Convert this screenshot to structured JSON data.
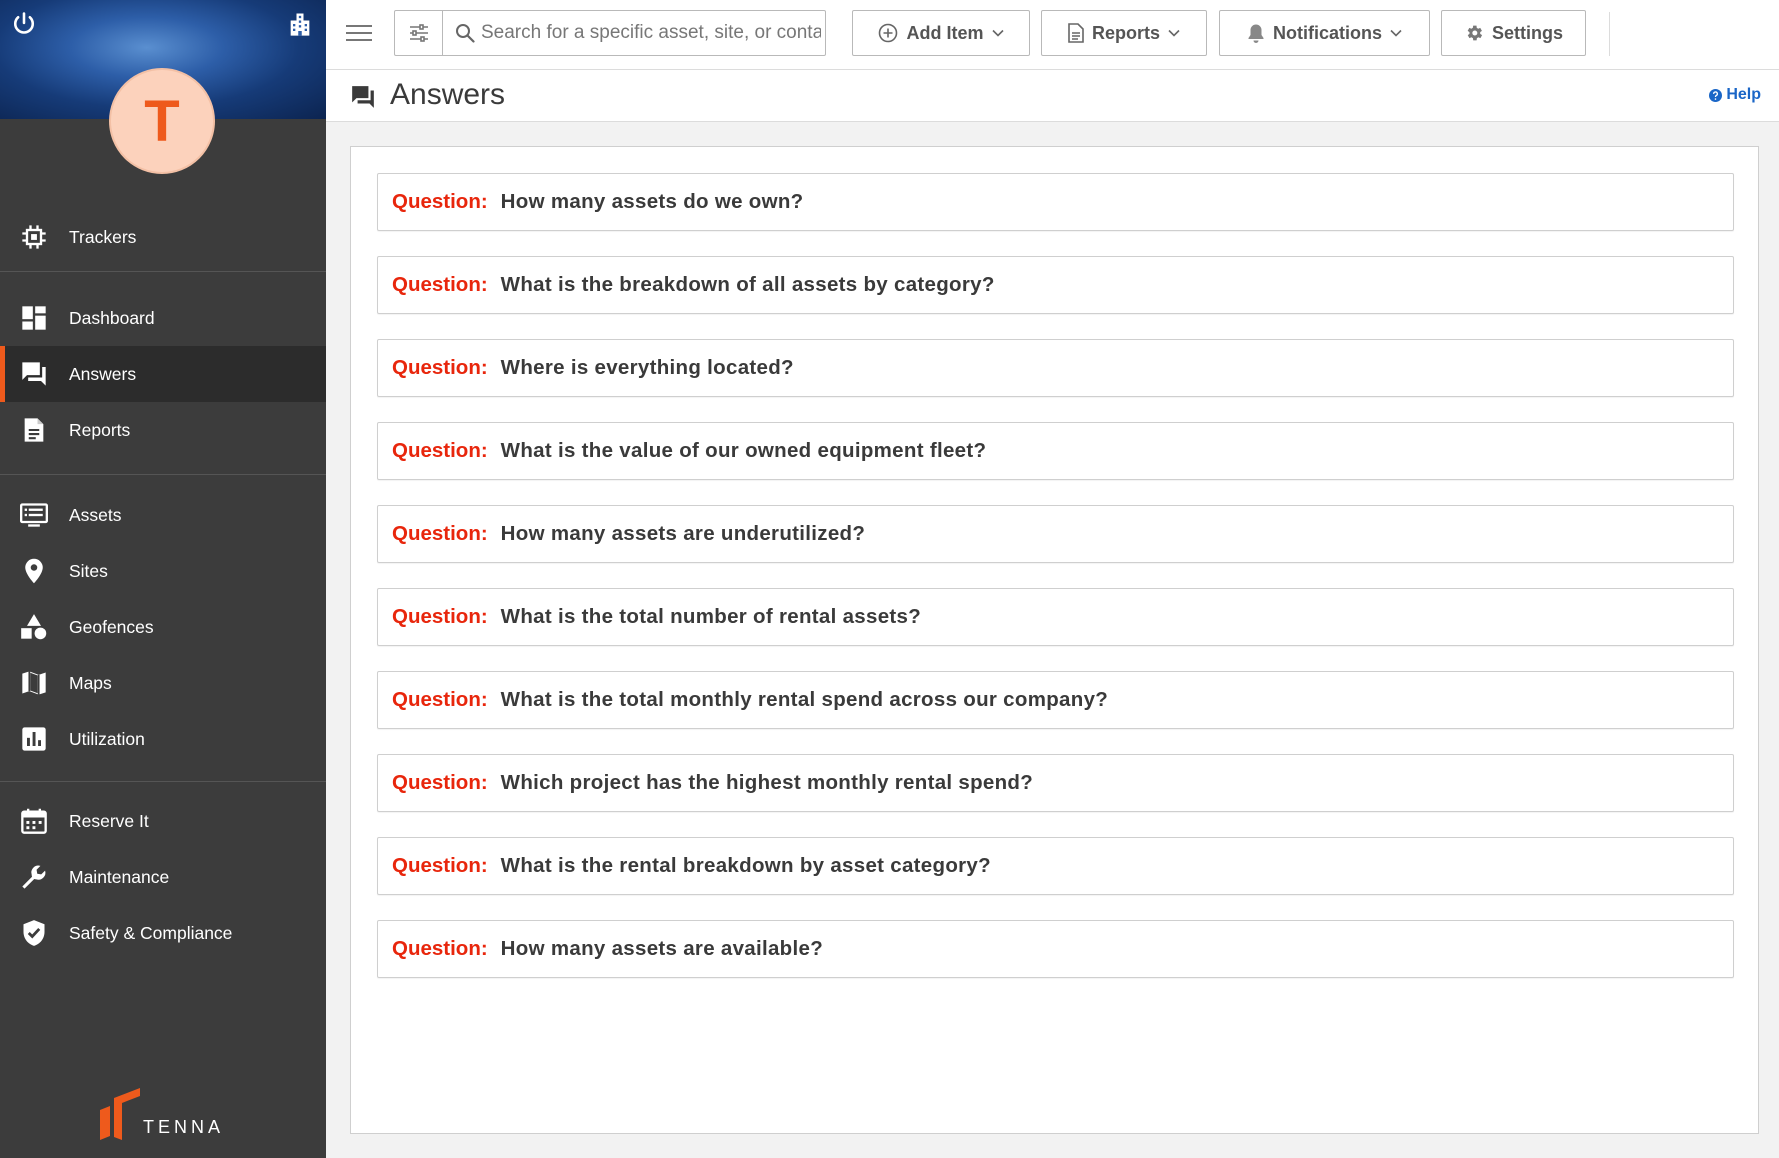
{
  "sidebar": {
    "avatar_initial": "T",
    "items": [
      {
        "label": "Trackers",
        "icon": "chip-icon"
      },
      {
        "label": "Dashboard",
        "icon": "dashboard-icon"
      },
      {
        "label": "Answers",
        "icon": "chat-icon",
        "active": true
      },
      {
        "label": "Reports",
        "icon": "document-icon"
      },
      {
        "label": "Assets",
        "icon": "monitor-list-icon"
      },
      {
        "label": "Sites",
        "icon": "location-pin-icon"
      },
      {
        "label": "Geofences",
        "icon": "shapes-icon"
      },
      {
        "label": "Maps",
        "icon": "map-icon"
      },
      {
        "label": "Utilization",
        "icon": "bar-chart-icon"
      },
      {
        "label": "Reserve It",
        "icon": "calendar-icon"
      },
      {
        "label": "Maintenance",
        "icon": "wrench-icon"
      },
      {
        "label": "Safety & Compliance",
        "icon": "shield-check-icon"
      }
    ],
    "brand": "TENNA"
  },
  "topbar": {
    "search_placeholder": "Search for a specific asset, site, or contact",
    "add_item_label": "Add Item",
    "reports_label": "Reports",
    "notifications_label": "Notifications",
    "settings_label": "Settings"
  },
  "page": {
    "title": "Answers",
    "help_label": "Help"
  },
  "questions": {
    "prefix": "Question:",
    "items": [
      "How many assets do we own?",
      "What is the breakdown of all assets by category?",
      "Where is everything located?",
      "What is the value of our owned equipment fleet?",
      "How many assets are underutilized?",
      "What is the total number of rental assets?",
      "What is the total monthly rental spend across our company?",
      "Which project has the highest monthly rental spend?",
      "What is the rental breakdown by asset category?",
      "How many assets are available?"
    ]
  },
  "colors": {
    "accent": "#ee5a1c",
    "question_prefix": "#e8260c",
    "help_link": "#1a66c7",
    "sidebar_bg": "#3c3c3c"
  }
}
